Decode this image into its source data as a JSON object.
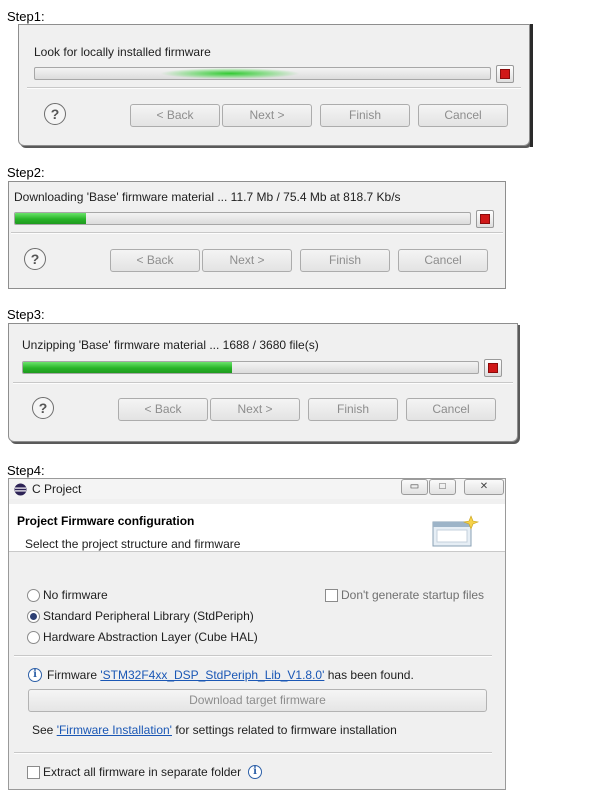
{
  "steps": [
    {
      "label": "Step1:",
      "status": "Look for locally installed firmware",
      "progress_indeterminate": true
    },
    {
      "label": "Step2:",
      "status": "Downloading 'Base' firmware material ... 11.7 Mb / 75.4 Mb at 818.7 Kb/s",
      "progress_fraction": 0.155
    },
    {
      "label": "Step3:",
      "status": "Unzipping 'Base' firmware material ... 1688 / 3680 file(s)",
      "progress_fraction": 0.459
    },
    {
      "label": "Step4:"
    }
  ],
  "wizard_buttons": {
    "help": "?",
    "back": "< Back",
    "next": "Next >",
    "finish": "Finish",
    "cancel": "Cancel"
  },
  "window": {
    "title": "C Project",
    "controls": {
      "minimize": "▭",
      "maximize": "□",
      "close": "✕"
    },
    "heading": "Project Firmware configuration",
    "subheading": "Select the project structure and firmware",
    "options": {
      "no_firmware": "No firmware",
      "stdperiph": "Standard Peripheral Library (StdPeriph)",
      "cube_hal": "Hardware Abstraction Layer (Cube HAL)",
      "selected": "stdperiph"
    },
    "dont_generate_startup": "Don't generate startup files",
    "firmware_found_prefix": "Firmware ",
    "firmware_name": "'STM32F4xx_DSP_StdPeriph_Lib_V1.8.0'",
    "firmware_found_suffix": " has been found.",
    "download_button": "Download target firmware",
    "see_prefix": "See ",
    "installation_link": "'Firmware Installation'",
    "see_suffix": " for settings related to firmware installation",
    "extract_all": "Extract all firmware in separate folder"
  },
  "colors": {
    "progress_green": "#28b428",
    "stop_red": "#d01818",
    "link_blue": "#1a57b5",
    "info_blue": "#2c5fa7"
  },
  "icons": {
    "help": "help-icon",
    "stop": "stop-icon",
    "info": "info-icon",
    "window": "eclipse-icon",
    "wizard": "wizard-banner-icon"
  }
}
